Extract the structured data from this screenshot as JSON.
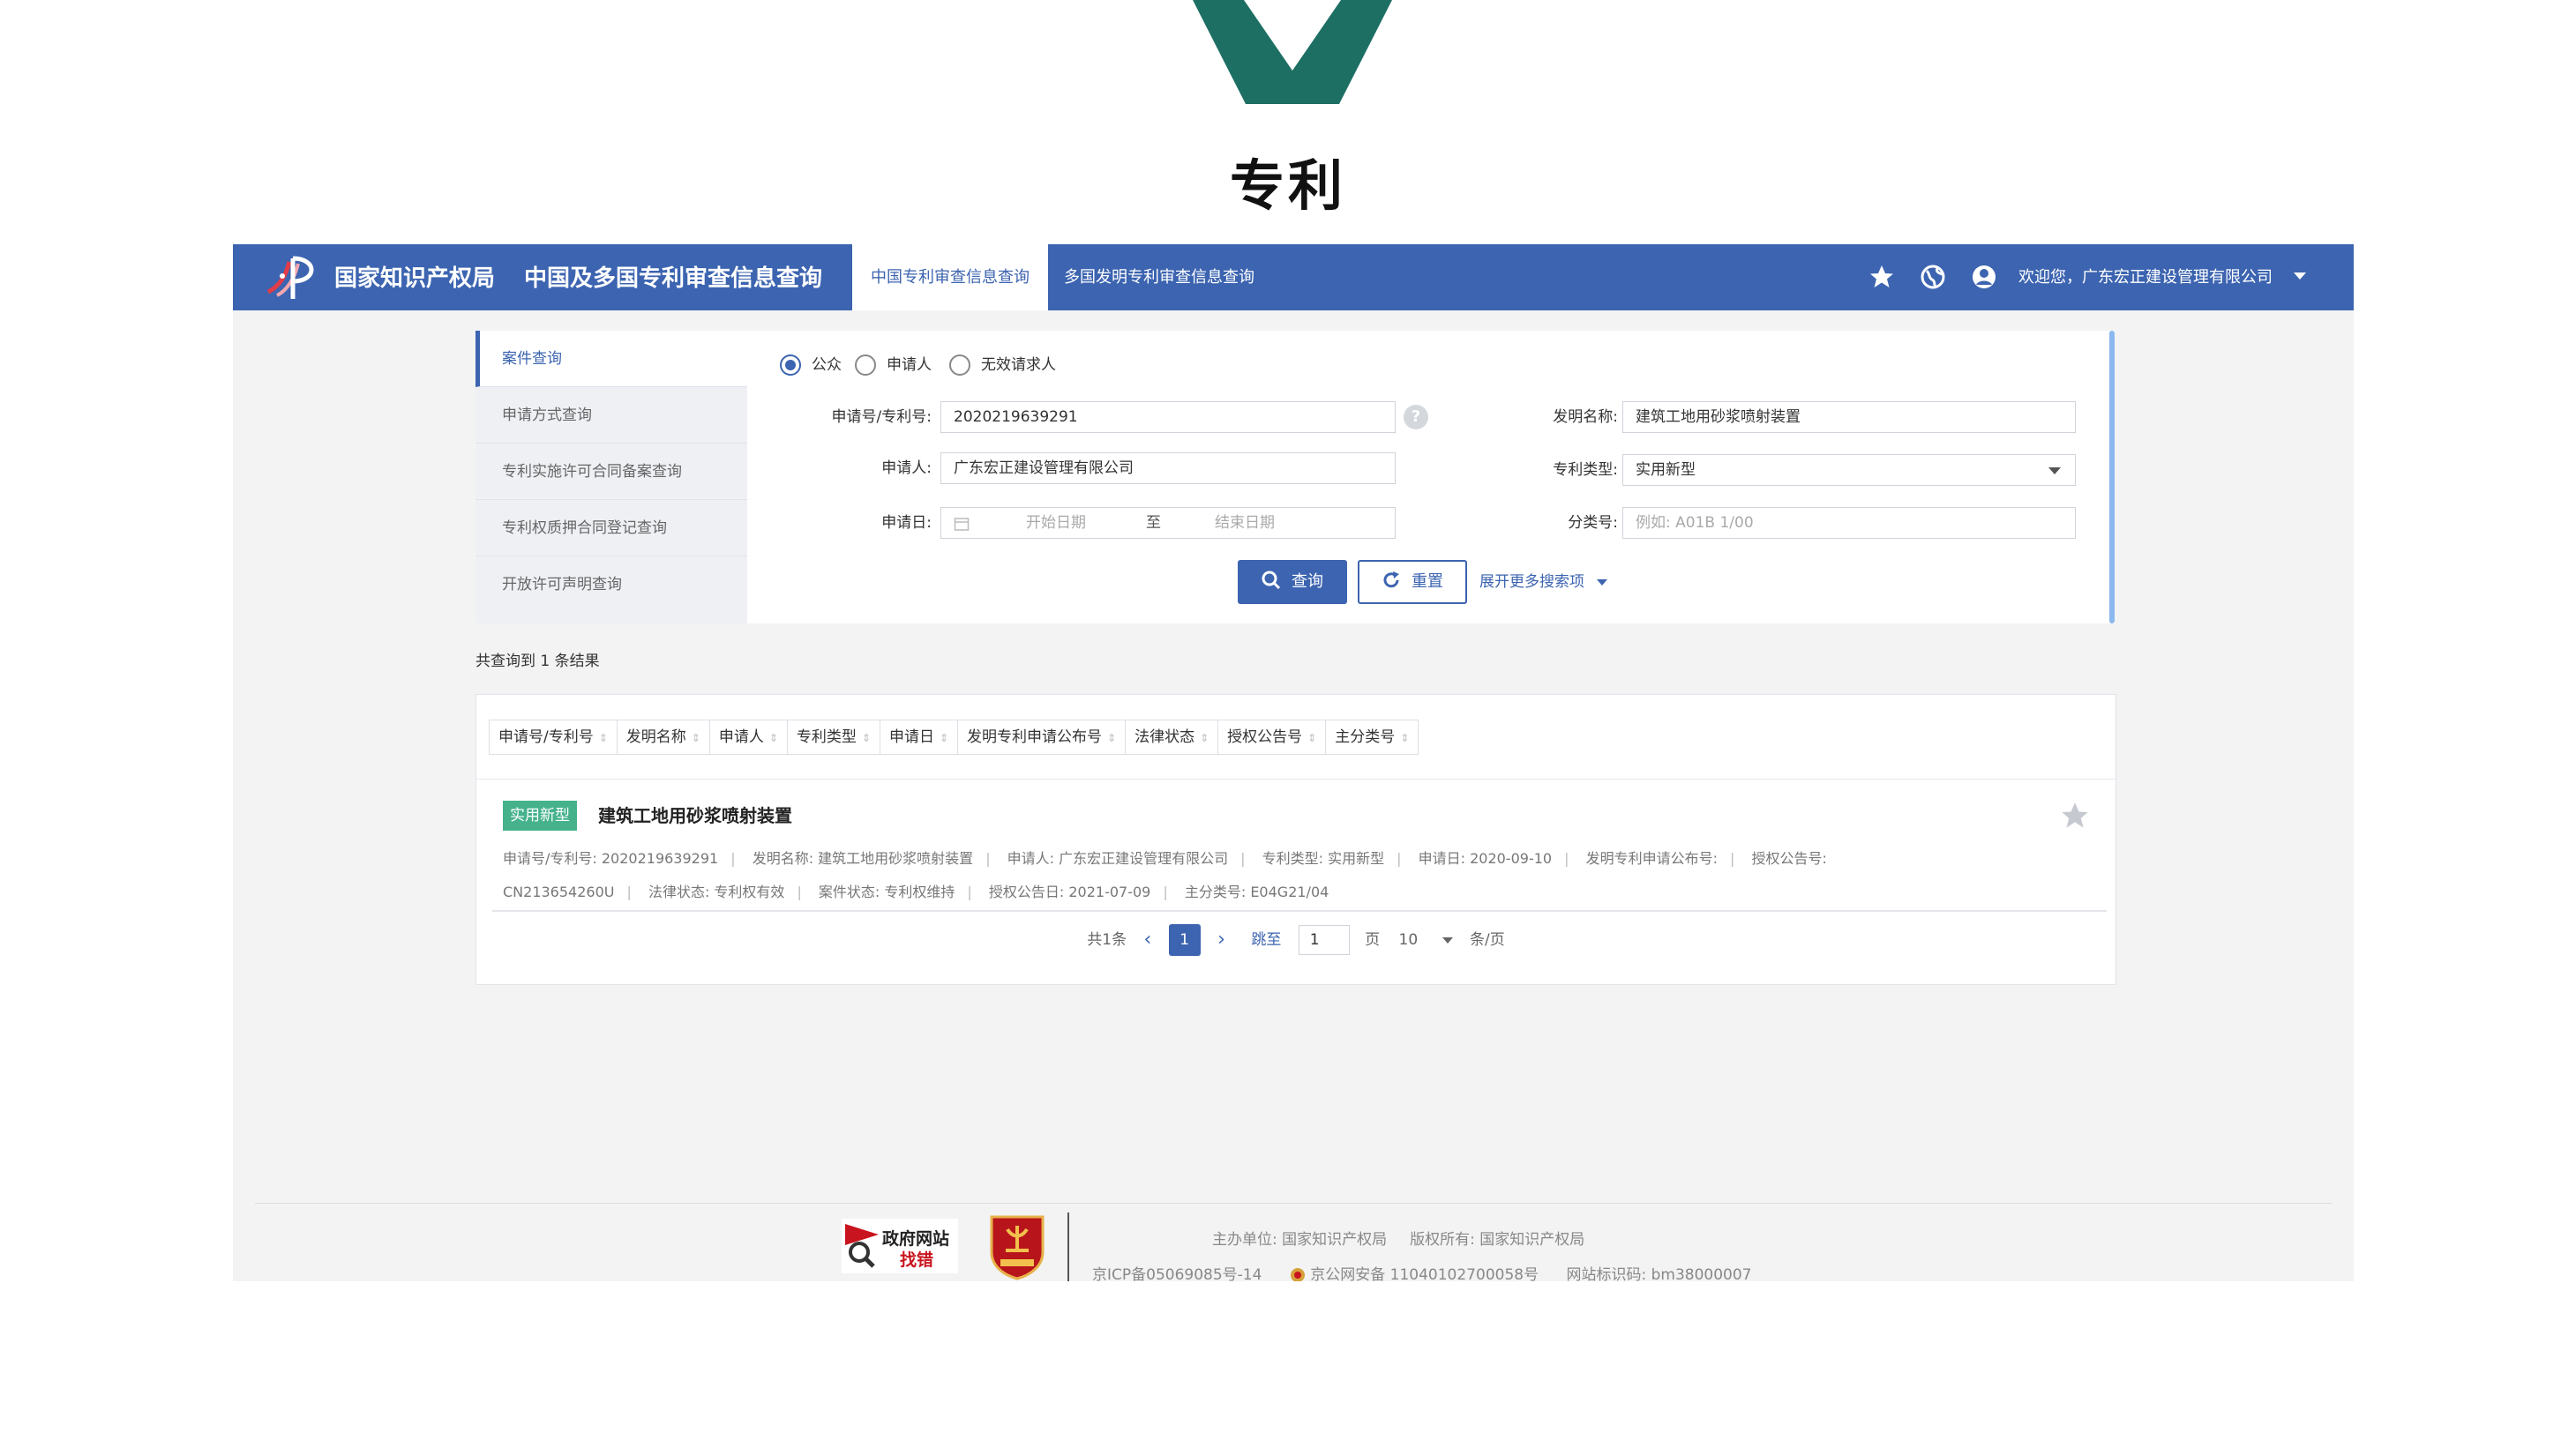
{
  "page_title": "专利",
  "colors": {
    "brand": "#3c64b0",
    "logo_green": "#1d6f63",
    "tag_green": "#45b28c"
  },
  "header": {
    "agency": "国家知识产权局",
    "system_title": "中国及多国专利审查信息查询",
    "tabs": [
      {
        "label": "中国专利审查信息查询",
        "active": true
      },
      {
        "label": "多国发明专利审查信息查询",
        "active": false
      }
    ],
    "icons": [
      "star-icon",
      "globe-icon",
      "user-icon"
    ],
    "welcome": "欢迎您，广东宏正建设管理有限公司"
  },
  "sidebar": {
    "items": [
      {
        "label": "案件查询",
        "active": true
      },
      {
        "label": "申请方式查询"
      },
      {
        "label": "专利实施许可合同备案查询"
      },
      {
        "label": "专利权质押合同登记查询"
      },
      {
        "label": "开放许可声明查询"
      }
    ]
  },
  "search": {
    "user_types": [
      {
        "label": "公众",
        "selected": true
      },
      {
        "label": "申请人",
        "selected": false
      },
      {
        "label": "无效请求人",
        "selected": false
      }
    ],
    "app_no_label": "申请号/专利号:",
    "app_no_value": "2020219639291",
    "help": "?",
    "invention_name_label": "发明名称:",
    "invention_name_value": "建筑工地用砂浆喷射装置",
    "applicant_label": "申请人:",
    "applicant_value": "广东宏正建设管理有限公司",
    "patent_type_label": "专利类型:",
    "patent_type_value": "实用新型",
    "date_label": "申请日:",
    "date_start_placeholder": "开始日期",
    "date_to": "至",
    "date_end_placeholder": "结束日期",
    "class_label": "分类号:",
    "class_placeholder": "例如: A01B 1/00",
    "query_button": "查询",
    "reset_button": "重置",
    "expand_link": "展开更多搜索项"
  },
  "results": {
    "count_text": "共查询到 1 条结果",
    "sort_columns": [
      "申请号/专利号",
      "发明名称",
      "申请人",
      "专利类型",
      "申请日",
      "发明专利申请公布号",
      "法律状态",
      "授权公告号",
      "主分类号"
    ],
    "items": [
      {
        "tag": "实用新型",
        "title": "建筑工地用砂浆喷射装置",
        "line1": [
          "申请号/专利号: 2020219639291",
          "发明名称: 建筑工地用砂浆喷射装置",
          "申请人: 广东宏正建设管理有限公司",
          "专利类型: 实用新型",
          "申请日: 2020-09-10",
          "发明专利申请公布号:",
          "授权公告号:"
        ],
        "line2": [
          "CN213654260U",
          "法律状态: 专利权有效",
          "案件状态: 专利权维持",
          "授权公告日: 2021-07-09",
          "主分类号: E04G21/04"
        ]
      }
    ],
    "pager": {
      "total": "共1条",
      "current": "1",
      "jump_label": "跳至",
      "jump_value": "1",
      "page_unit": "页",
      "page_size": "10",
      "size_unit": "条/页"
    }
  },
  "footer": {
    "gov_badge_line1": "政府网站",
    "gov_badge_line2": "找错",
    "sponsor": "主办单位: 国家知识产权局",
    "copyright": "版权所有: 国家知识产权局",
    "icp": "京ICP备05069085号-14",
    "police": "京公网安备 11040102700058号",
    "site_code": "网站标识码: bm38000007"
  }
}
